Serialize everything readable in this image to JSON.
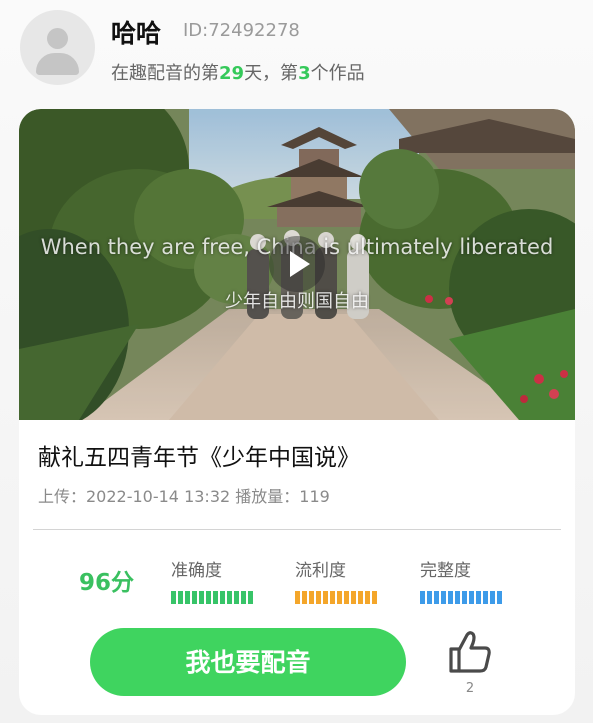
{
  "user": {
    "name": "哈哈",
    "id_text": "ID:72492278",
    "stats_prefix": "在趣配音的第",
    "days": "29",
    "stats_middle": "天，第",
    "works": "3",
    "stats_suffix": "个作品"
  },
  "video": {
    "subtitle_en": "When they are free, China is ultimately liberated",
    "subtitle_zh": "少年自由则国自由",
    "play_icon": "play-icon"
  },
  "work": {
    "title": "献礼五四青年节《少年中国说》",
    "meta": "上传：2022-10-14 13:32 播放量：119"
  },
  "scores": {
    "total": "96分",
    "metrics": [
      {
        "label": "准确度",
        "color": "#37c468",
        "level": 1.0
      },
      {
        "label": "流利度",
        "color": "#f4a62a",
        "level": 1.0
      },
      {
        "label": "完整度",
        "color": "#3d9be9",
        "level": 1.0
      }
    ]
  },
  "actions": {
    "cta_label": "我也要配音",
    "like_count": "2",
    "like_icon": "thumbs-up-icon"
  }
}
